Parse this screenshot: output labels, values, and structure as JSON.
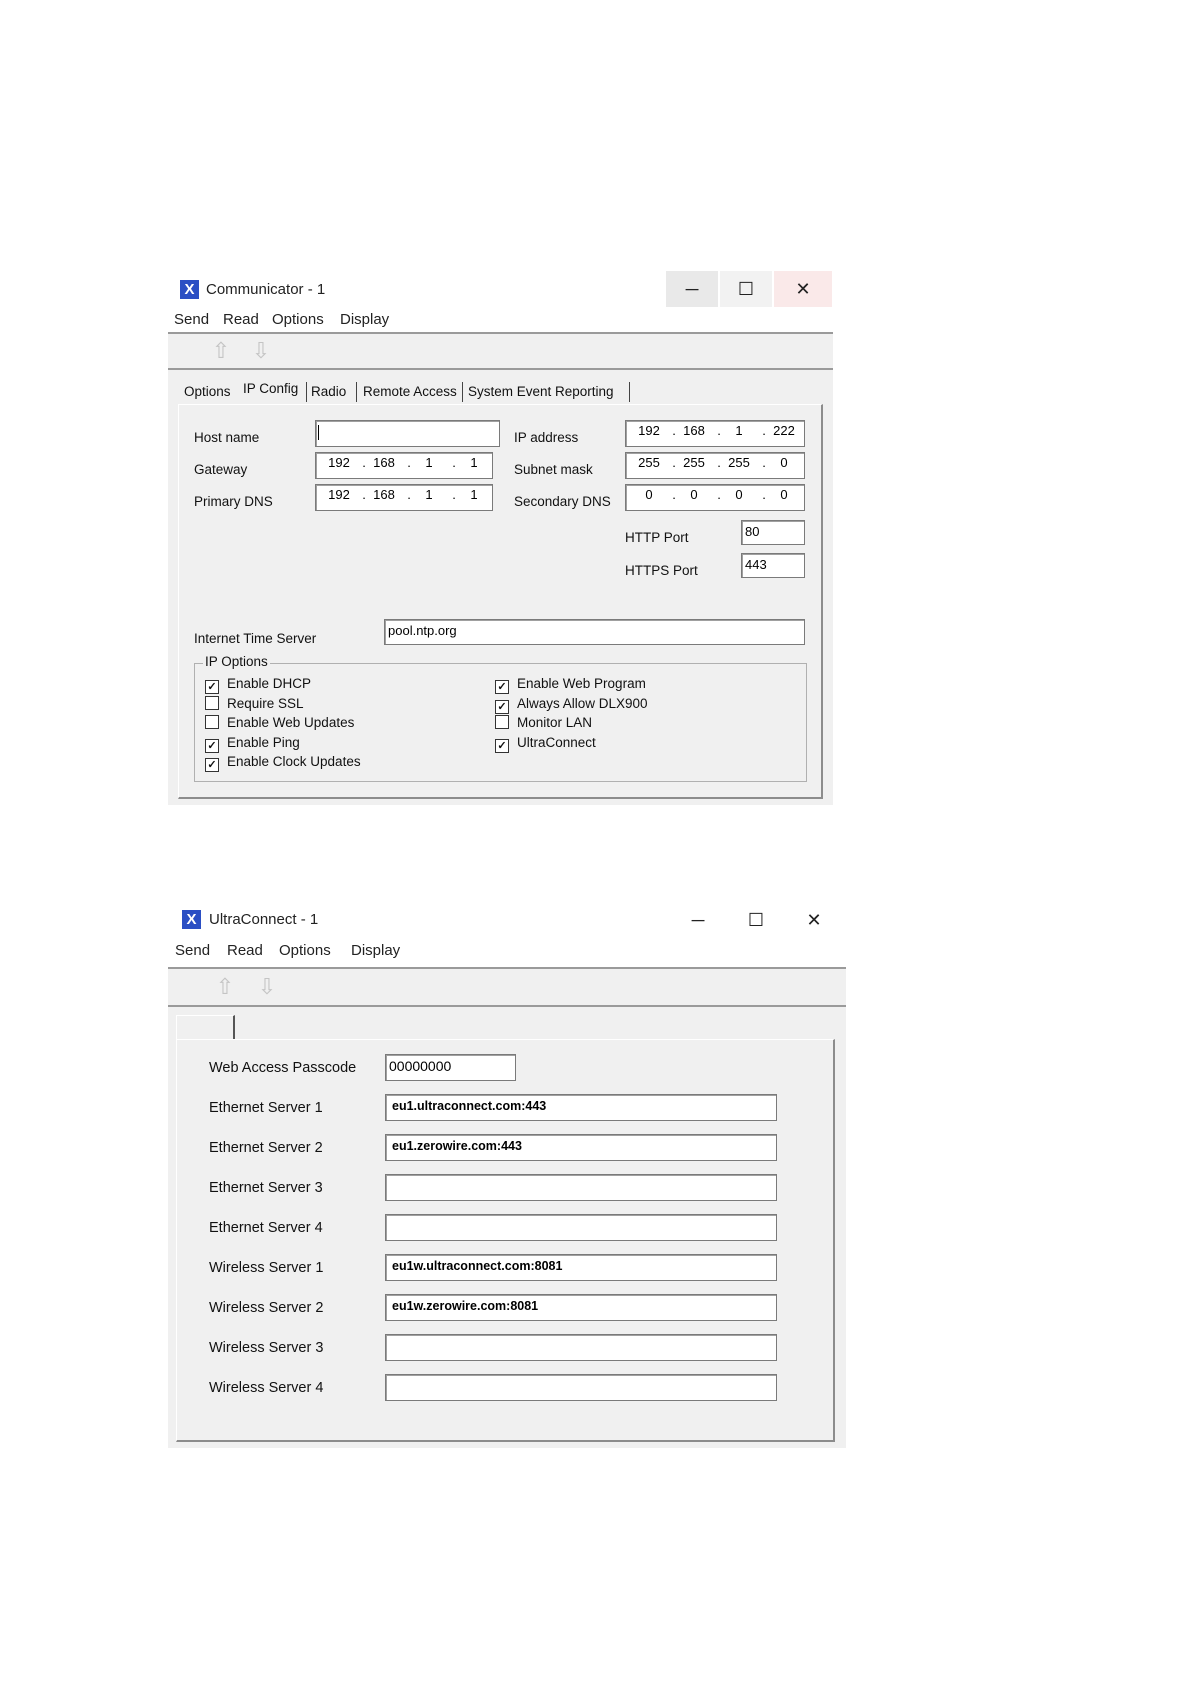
{
  "communicator": {
    "title": "Communicator - 1",
    "icon": "x-app-icon",
    "window_controls": {
      "minimize": "─",
      "maximize": "☐",
      "close": "✕"
    },
    "menu": [
      "Send",
      "Read",
      "Options",
      "Display"
    ],
    "toolbar": {
      "upload_icon": "upload-icon",
      "download_icon": "download-icon"
    },
    "tabs": [
      "Options",
      "IP Config",
      "Radio",
      "Remote Access",
      "System Event Reporting"
    ],
    "active_tab": "IP Config",
    "fields": {
      "host_name": {
        "label": "Host name",
        "value": ""
      },
      "gateway": {
        "label": "Gateway",
        "octets": [
          "192",
          "168",
          "1",
          "1"
        ]
      },
      "primary_dns": {
        "label": "Primary DNS",
        "octets": [
          "192",
          "168",
          "1",
          "1"
        ]
      },
      "ip_address": {
        "label": "IP address",
        "octets": [
          "192",
          "168",
          "1",
          "222"
        ]
      },
      "subnet_mask": {
        "label": "Subnet mask",
        "octets": [
          "255",
          "255",
          "255",
          "0"
        ]
      },
      "secondary_dns": {
        "label": "Secondary DNS",
        "octets": [
          "0",
          "0",
          "0",
          "0"
        ]
      },
      "http_port": {
        "label": "HTTP Port",
        "value": "80"
      },
      "https_port": {
        "label": "HTTPS Port",
        "value": "443"
      },
      "internet_time_server": {
        "label": "Internet Time Server",
        "value": "pool.ntp.org"
      }
    },
    "ip_options": {
      "title": "IP Options",
      "left": [
        {
          "label": "Enable DHCP",
          "checked": true
        },
        {
          "label": "Require SSL",
          "checked": false
        },
        {
          "label": "Enable Web Updates",
          "checked": false
        },
        {
          "label": "Enable Ping",
          "checked": true
        },
        {
          "label": "Enable Clock Updates",
          "checked": true
        }
      ],
      "right": [
        {
          "label": "Enable Web Program",
          "checked": true
        },
        {
          "label": "Always Allow DLX900",
          "checked": true
        },
        {
          "label": "Monitor LAN",
          "checked": false
        },
        {
          "label": "UltraConnect",
          "checked": true
        }
      ]
    }
  },
  "ultraconnect": {
    "title": "UltraConnect - 1",
    "icon": "x-app-icon",
    "window_controls": {
      "minimize": "─",
      "maximize": "☐",
      "close": "✕"
    },
    "menu": [
      "Send",
      "Read",
      "Options",
      "Display"
    ],
    "toolbar": {
      "upload_icon": "upload-icon",
      "download_icon": "download-icon"
    },
    "fields": [
      {
        "label": "Web Access Passcode",
        "value": "00000000"
      },
      {
        "label": "Ethernet Server 1",
        "value": "eu1.ultraconnect.com:443"
      },
      {
        "label": "Ethernet Server 2",
        "value": "eu1.zerowire.com:443"
      },
      {
        "label": "Ethernet Server 3",
        "value": ""
      },
      {
        "label": "Ethernet Server 4",
        "value": ""
      },
      {
        "label": "Wireless Server 1",
        "value": "eu1w.ultraconnect.com:8081"
      },
      {
        "label": "Wireless Server 2",
        "value": "eu1w.zerowire.com:8081"
      },
      {
        "label": "Wireless Server 3",
        "value": ""
      },
      {
        "label": "Wireless Server 4",
        "value": ""
      }
    ]
  }
}
